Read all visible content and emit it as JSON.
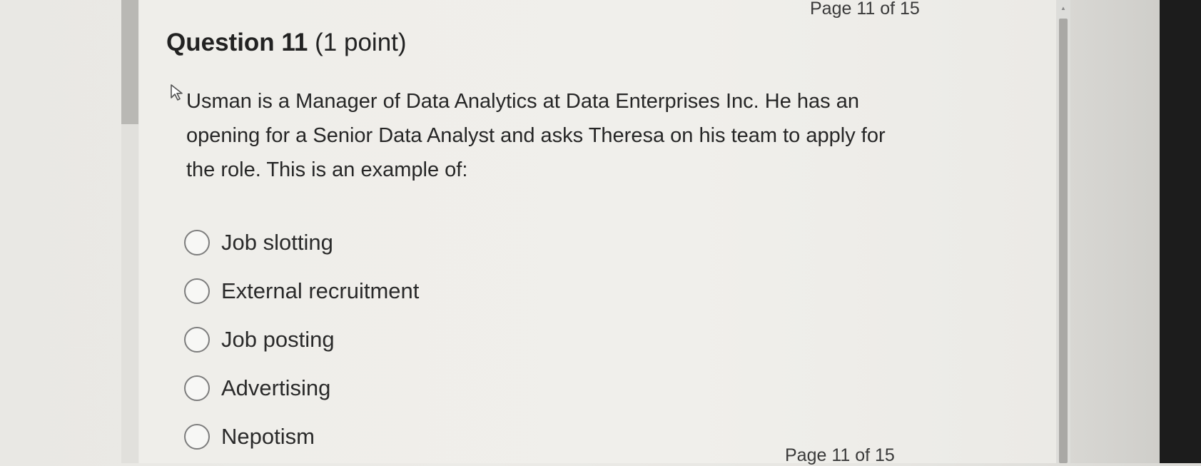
{
  "pagination": {
    "top": "Page 11 of 15",
    "bottom": "Page 11 of 15"
  },
  "question": {
    "title": "Question 11",
    "points": "(1 point)",
    "text": "Usman is a Manager of Data Analytics at Data Enterprises Inc. He has an opening for a Senior Data Analyst and asks Theresa on his team to apply for the role. This is an example of:"
  },
  "options": [
    {
      "label": "Job slotting",
      "selected": false
    },
    {
      "label": "External recruitment",
      "selected": false
    },
    {
      "label": "Job posting",
      "selected": false
    },
    {
      "label": "Advertising",
      "selected": false
    },
    {
      "label": "Nepotism",
      "selected": false
    }
  ],
  "icons": {
    "cursor": "mouse-pointer-icon",
    "scroll_up": "scroll-up-arrow-icon"
  },
  "colors": {
    "page_background": "#efeeea",
    "text": "#262626",
    "radio_border": "#7d7d7d",
    "scrollbar_thumb": "#a9a8a5"
  }
}
